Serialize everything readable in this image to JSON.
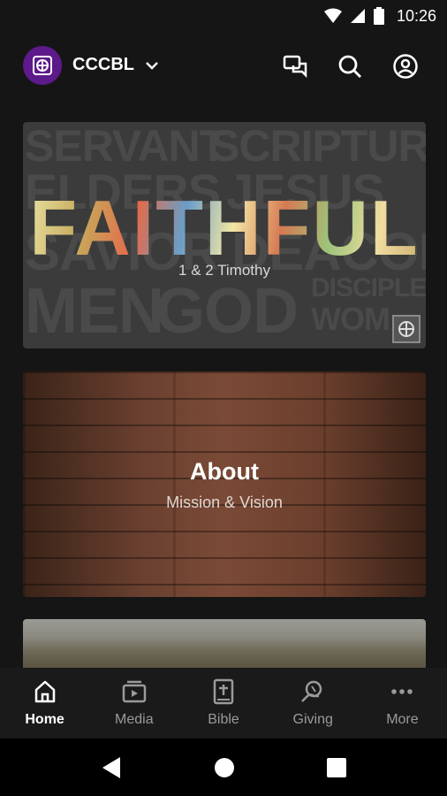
{
  "status": {
    "time": "10:26"
  },
  "header": {
    "app_name": "CCCBL"
  },
  "series_card": {
    "bg_words": [
      "SERVANT",
      "SCRIPTURE",
      "ELDERS",
      "JESUS",
      "SAVIOR",
      "DEACONS",
      "MEN",
      "GOD",
      "DISCIPLES",
      "WOM"
    ],
    "title": "FAITHFUL",
    "subtitle": "1 & 2 Timothy"
  },
  "about_card": {
    "title": "About",
    "subtitle": "Mission & Vision"
  },
  "bottom_nav": {
    "items": [
      {
        "label": "Home",
        "icon": "home-icon",
        "active": true
      },
      {
        "label": "Media",
        "icon": "media-icon",
        "active": false
      },
      {
        "label": "Bible",
        "icon": "bible-icon",
        "active": false
      },
      {
        "label": "Giving",
        "icon": "giving-icon",
        "active": false
      },
      {
        "label": "More",
        "icon": "more-icon",
        "active": false
      }
    ]
  },
  "colors": {
    "brand": "#5d1a8a",
    "background": "#151515"
  }
}
